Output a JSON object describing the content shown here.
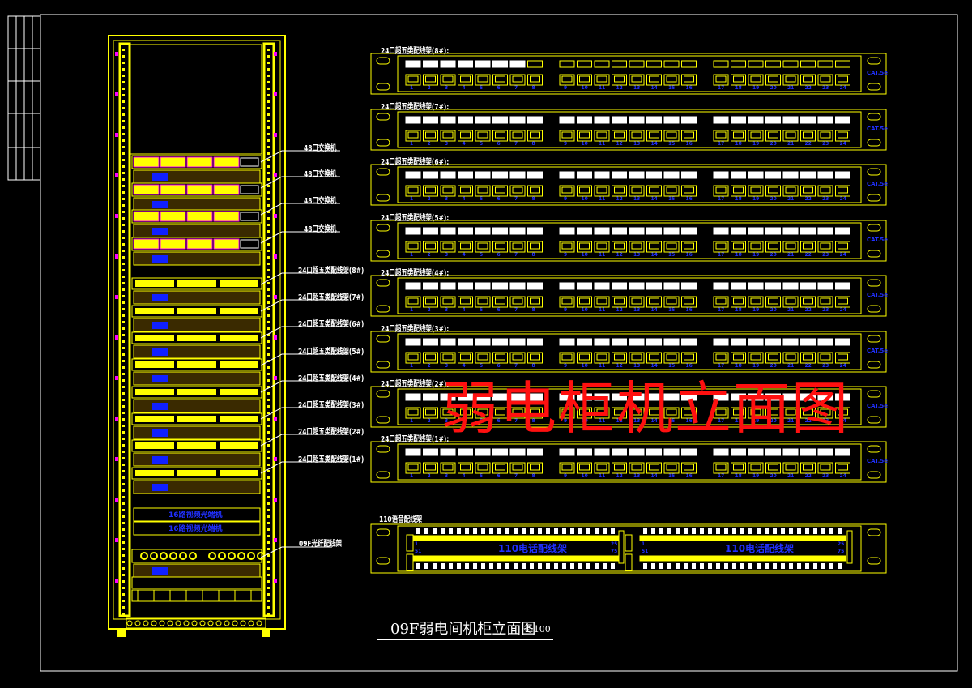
{
  "colors": {
    "background": "#000000",
    "frame": "#ffffff",
    "equipment": "#ffff00",
    "port_numbers": "#2030ff",
    "accent": "#ff00ff",
    "watermark": "#ff1010"
  },
  "rack_labels": {
    "switches": [
      "48口交换机",
      "48口交换机",
      "48口交换机",
      "48口交换机"
    ],
    "patch_panels": [
      "24口超五类配线架(8#)",
      "24口超五类配线架(7#)",
      "24口超五类配线架(6#)",
      "24口超五类配线架(5#)",
      "24口超五类配线架(4#)",
      "24口超五类配线架(3#)",
      "24口超五类配线架(2#)",
      "24口超五类配线架(1#)"
    ],
    "fiber": "09F光纤配线架",
    "video_units": [
      "16路视频光端机",
      "16路视频光端机"
    ]
  },
  "patch_panels": [
    {
      "title": "24口超五类配线架(8#):"
    },
    {
      "title": "24口超五类配线架(7#):"
    },
    {
      "title": "24口超五类配线架(6#):"
    },
    {
      "title": "24口超五类配线架(5#):"
    },
    {
      "title": "24口超五类配线架(4#):"
    },
    {
      "title": "24口超五类配线架(3#):"
    },
    {
      "title": "24口超五类配线架(2#):"
    },
    {
      "title": "24口超五类配线架(1#):"
    }
  ],
  "panel_badge": "CAT.5e",
  "port_numbers": [
    "1",
    "2",
    "3",
    "4",
    "5",
    "6",
    "7",
    "8",
    "9",
    "10",
    "11",
    "12",
    "13",
    "14",
    "15",
    "16",
    "17",
    "18",
    "19",
    "20",
    "21",
    "22",
    "23",
    "24"
  ],
  "voice_panel": {
    "title": "110语音配线架",
    "label": "110电话配线架",
    "left_top": "1",
    "left_bottom": "51",
    "right_top": "25",
    "right_bottom": "75"
  },
  "drawing_title": "09F弱电间机柜立面图",
  "scale": "1:100",
  "watermark": "弱电柜机立面图"
}
